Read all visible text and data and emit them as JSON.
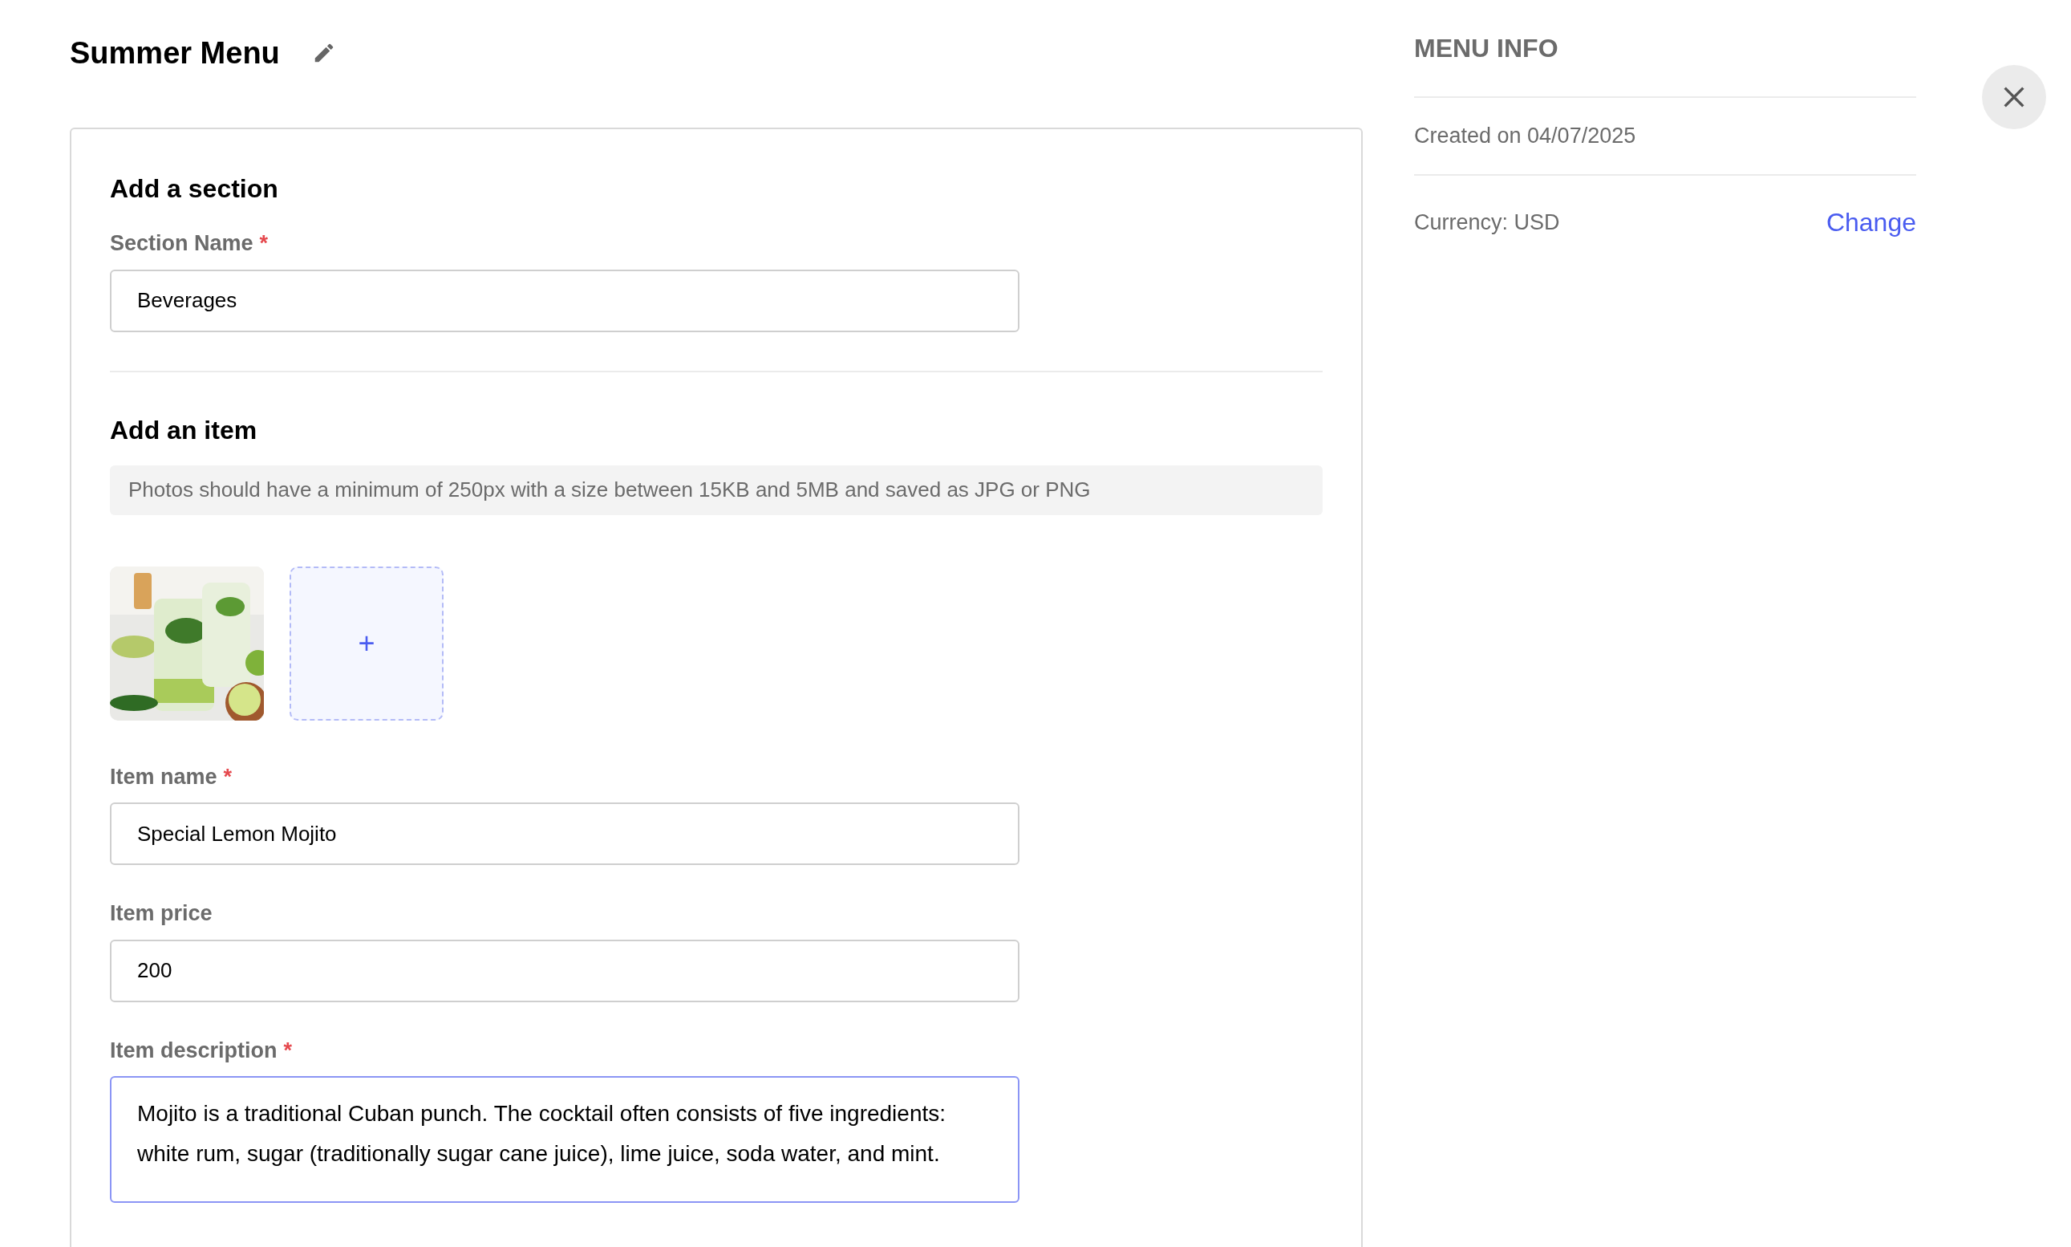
{
  "header": {
    "title": "Summer Menu"
  },
  "section_form": {
    "heading": "Add a section",
    "field": {
      "label": "Section Name",
      "required_mark": "*",
      "value": "Beverages"
    }
  },
  "item_form": {
    "heading": "Add an item",
    "notice": "Photos should have a minimum of 250px with a size between 15KB and 5MB and saved as JPG or PNG",
    "add_photo": {
      "label": "+"
    },
    "fields": [
      {
        "kind": "input",
        "label": "Item name",
        "required_mark": "*",
        "value": "Special Lemon Mojito",
        "focused": false
      },
      {
        "kind": "input",
        "label": "Item price",
        "value": "200",
        "focused": false
      },
      {
        "kind": "textarea",
        "label": "Item description",
        "required_mark": "*",
        "value": "Mojito is a traditional Cuban punch. The cocktail often consists of five ingredients: white rum, sugar (traditionally sugar cane juice), lime juice, soda water, and mint.",
        "focused": true
      }
    ]
  },
  "menu_info": {
    "heading": "MENU INFO",
    "created": "Created on 04/07/2025",
    "currency": "Currency: USD",
    "change_link": "Change"
  }
}
